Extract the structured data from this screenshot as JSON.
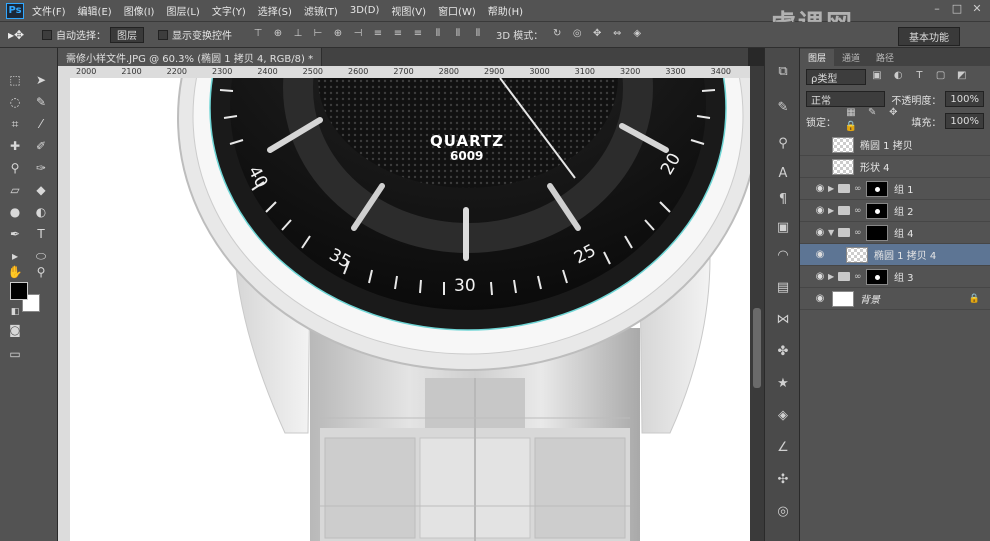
{
  "menubar": {
    "logo": "Ps",
    "items": [
      "文件(F)",
      "编辑(E)",
      "图像(I)",
      "图层(L)",
      "文字(Y)",
      "选择(S)",
      "滤镜(T)",
      "3D(D)",
      "视图(V)",
      "窗口(W)",
      "帮助(H)"
    ],
    "window_controls": [
      "–",
      "□",
      "✕"
    ]
  },
  "options": {
    "auto_select_label": "自动选择：",
    "auto_select_value": "图层",
    "show_transform_label": "显示变换控件",
    "mode_3d_label": "3D 模式：",
    "workspace_label": "基本功能"
  },
  "document": {
    "tab_title": "需修小样文件.JPG @ 60.3% (椭圆 1 拷贝 4, RGB/8) *"
  },
  "ruler": {
    "top_ticks": [
      "2000",
      "2100",
      "2200",
      "2300",
      "2400",
      "2500",
      "2600",
      "2700",
      "2800",
      "2900",
      "3000",
      "3100",
      "3200",
      "3300",
      "3400"
    ]
  },
  "watch": {
    "brand": "QUARTZ",
    "model": "6009",
    "dial_numbers": [
      "40",
      "35",
      "30",
      "25",
      "20"
    ]
  },
  "layers_panel": {
    "tabs": [
      "图层",
      "通道",
      "路径"
    ],
    "filter_kind": "ρ类型",
    "blend_mode": "正常",
    "opacity_label": "不透明度：",
    "opacity_value": "100%",
    "lock_label": "锁定：",
    "fill_label": "填充：",
    "fill_value": "100%",
    "layers": [
      {
        "name": "椭圆 1 拷贝",
        "visible": false,
        "type": "shape"
      },
      {
        "name": "形状 4",
        "visible": false,
        "type": "shape"
      },
      {
        "name": "组 1",
        "visible": true,
        "type": "group"
      },
      {
        "name": "组 2",
        "visible": true,
        "type": "group"
      },
      {
        "name": "组 4",
        "visible": true,
        "type": "group-open"
      },
      {
        "name": "椭圆 1 拷贝 4",
        "visible": true,
        "type": "child"
      },
      {
        "name": "组 3",
        "visible": true,
        "type": "group"
      },
      {
        "name": "背景",
        "visible": true,
        "type": "background"
      }
    ]
  },
  "watermark_text": "虎课网"
}
